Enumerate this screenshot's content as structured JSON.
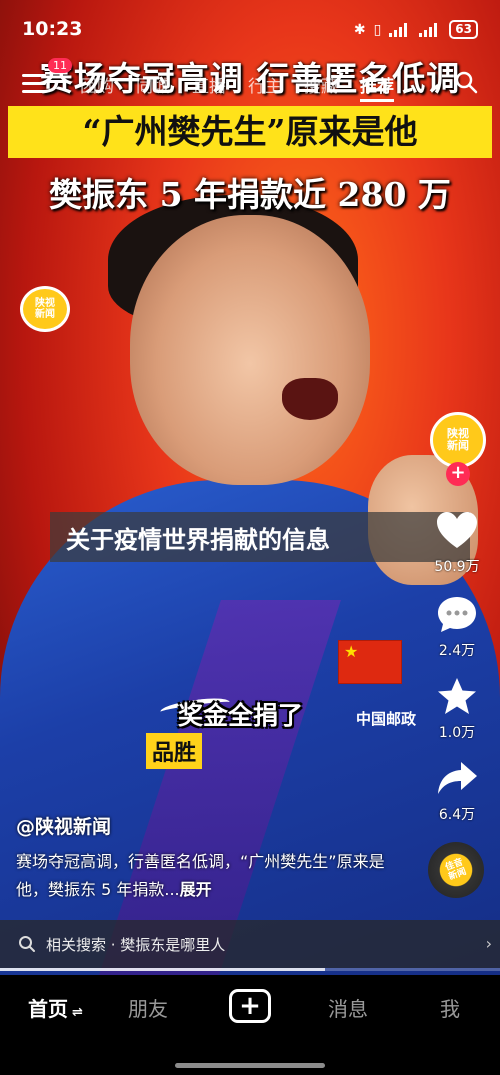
{
  "status_bar": {
    "time": "10:23",
    "battery": "63",
    "icons": [
      "bluetooth-icon",
      "vibrate-icon",
      "signal-icon",
      "signal-icon",
      "battery-icon"
    ]
  },
  "top_nav": {
    "badge_count": "11",
    "tabs": [
      {
        "label": "团购",
        "active": false
      },
      {
        "label": "同城",
        "active": false
      },
      {
        "label": "直播",
        "active": false
      },
      {
        "label": "行主",
        "active": false
      },
      {
        "label": "搜藏",
        "active": false
      },
      {
        "label": "推荐",
        "active": true
      }
    ]
  },
  "video": {
    "headline_1": "赛场夺冠高调 行善匿名低调",
    "headline_2": "“广州樊先生”原来是他",
    "headline_3": "樊振东 5 年捐款近 280 万",
    "watermark": "陕视\n新闻",
    "caption_1": "奖金全捐了",
    "caption_2": "品胜",
    "sponsor": "中国邮政",
    "progress": 0.65
  },
  "article_banner": {
    "title": "关于疫情世界捐献的信息"
  },
  "right_rail": {
    "avatar_text": "陕视\n新闻",
    "like_count": "50.9万",
    "comment_count": "2.4万",
    "favorite_count": "1.0万",
    "share_count": "6.4万",
    "disc_text": "佳音\n新闻"
  },
  "post": {
    "author": "@陕视新闻",
    "description": "赛场夺冠高调，行善匿名低调，“广州樊先生”原来是他，樊振东 5 年捐款...",
    "expand": "展开"
  },
  "related_search": {
    "text": "相关搜索 · 樊振东是哪里人"
  },
  "bottom_nav": {
    "home": "首页",
    "friends": "朋友",
    "messages": "消息",
    "me": "我"
  },
  "colors": {
    "accent_red": "#ff2c55",
    "headline_yellow": "#ffe21a",
    "jersey_blue": "#1c3fa8"
  }
}
